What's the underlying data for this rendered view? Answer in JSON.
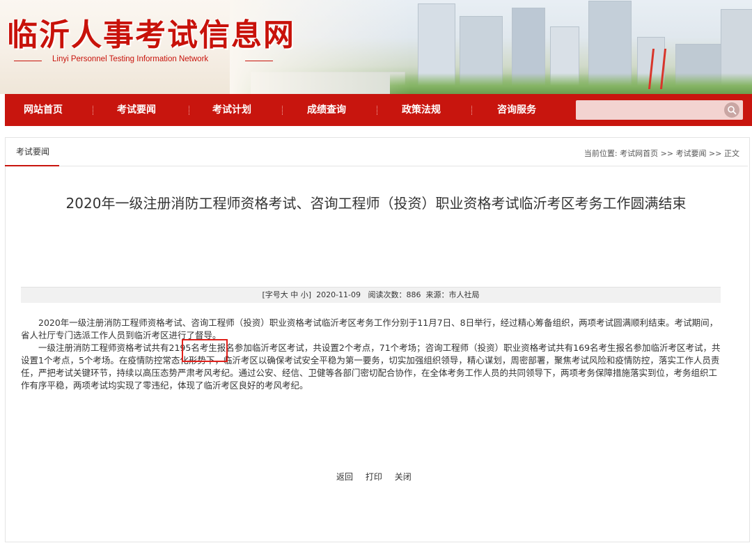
{
  "header": {
    "site_title": "临沂人事考试信息网",
    "site_subtitle": "Linyi Personnel Testing Information Network"
  },
  "nav": {
    "items": [
      {
        "label": "网站首页"
      },
      {
        "label": "考试要闻"
      },
      {
        "label": "考试计划"
      },
      {
        "label": "成绩查询"
      },
      {
        "label": "政策法规"
      },
      {
        "label": "咨询服务"
      }
    ],
    "search": {
      "placeholder": "",
      "icon": "search-icon"
    }
  },
  "section": {
    "tab_label": "考试要闻",
    "breadcrumb": {
      "prefix": "当前位置: ",
      "home": "考试网首页",
      "sep1": " >> ",
      "section": "考试要闻",
      "sep2": " >> ",
      "current": "正文"
    }
  },
  "article": {
    "title": "2020年一级注册消防工程师资格考试、咨询工程师（投资）职业资格考试临沂考区考务工作圆满结束",
    "meta": {
      "font_size_label": "[字号",
      "size_large": "大",
      "size_medium": "中",
      "size_small": "小]",
      "date": "2020-11-09",
      "views_label": "阅读次数：",
      "views": "886",
      "source_label": "来源：",
      "source": "市人社局"
    },
    "paragraphs": [
      "2020年一级注册消防工程师资格考试、咨询工程师（投资）职业资格考试临沂考区考务工作分别于11月7日、8日举行，经过精心筹备组织，两项考试圆满顺利结束。考试期间，省人社厅专门选派工作人员到临沂考区进行了督导。",
      "一级注册消防工程师资格考试共有2195名考生报名参加临沂考区考试，共设置2个考点，71个考场；咨询工程师（投资）职业资格考试共有169名考生报名参加临沂考区考试，共设置1个考点，5个考场。在疫情防控常态化形势下，临沂考区以确保考试安全平稳为第一要务，切实加强组织领导，精心谋划，周密部署，聚焦考试风险和疫情防控，落实工作人员责任，严把考试关键环节，持续以高压态势严肃考风考纪。通过公安、经信、卫健等各部门密切配合协作，在全体考务工作人员的共同领导下，两项考务保障措施落实到位，考务组织工作有序平稳，两项考试均实现了零违纪，体现了临沂考区良好的考风考纪。"
    ]
  },
  "footer": {
    "back": "返回",
    "print": "打印",
    "close": "关闭"
  },
  "colors": {
    "brand_red": "#c8150e",
    "highlight_red": "#e0201a"
  }
}
